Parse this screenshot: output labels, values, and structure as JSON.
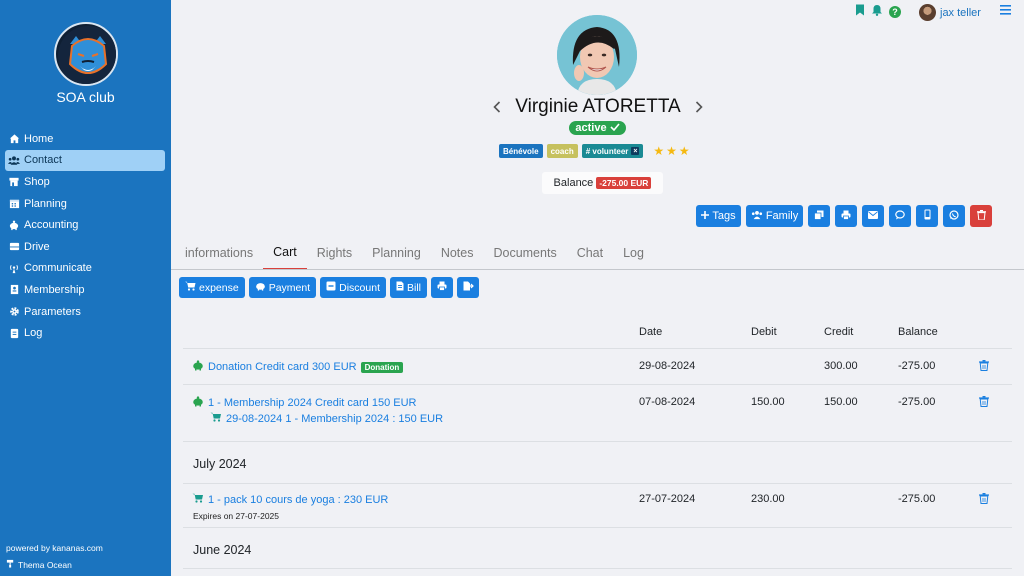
{
  "sidebar": {
    "club_name": "SOA club",
    "nav": [
      {
        "label": "Home",
        "icon": "home-icon",
        "active": false
      },
      {
        "label": "Contact",
        "icon": "users-icon",
        "active": true
      },
      {
        "label": "Shop",
        "icon": "shop-icon",
        "active": false
      },
      {
        "label": "Planning",
        "icon": "calendar-icon",
        "active": false
      },
      {
        "label": "Accounting",
        "icon": "piggy-bank-icon",
        "active": false
      },
      {
        "label": "Drive",
        "icon": "drive-icon",
        "active": false
      },
      {
        "label": "Communicate",
        "icon": "broadcast-icon",
        "active": false
      },
      {
        "label": "Membership",
        "icon": "id-card-icon",
        "active": false
      },
      {
        "label": "Parameters",
        "icon": "gear-icon",
        "active": false
      },
      {
        "label": "Log",
        "icon": "log-icon",
        "active": false
      }
    ],
    "powered_by": "powered by kananas.com",
    "theme": "Thema Ocean"
  },
  "topbar": {
    "user_name": "jax teller",
    "help_label": "?"
  },
  "profile": {
    "name": "Virginie ATORETTA",
    "status": "active",
    "tags": [
      {
        "label": "Bénévole",
        "style": "blue"
      },
      {
        "label": "coach",
        "style": "yellow"
      },
      {
        "label": "# volunteer",
        "style": "teal",
        "removable": true,
        "remove_label": "×"
      }
    ],
    "rating": 3,
    "balance_label": "Balance",
    "balance_amount": "-275.00 EUR"
  },
  "actions": {
    "tags": "Tags",
    "family": "Family",
    "icons": [
      "copy-icon",
      "print-icon",
      "email-icon",
      "chat-icon",
      "mobile-icon",
      "whatsapp-icon",
      "trash-icon"
    ]
  },
  "tabs": [
    {
      "label": "informations",
      "active": false
    },
    {
      "label": "Cart",
      "active": true
    },
    {
      "label": "Rights",
      "active": false
    },
    {
      "label": "Planning",
      "active": false
    },
    {
      "label": "Notes",
      "active": false
    },
    {
      "label": "Documents",
      "active": false
    },
    {
      "label": "Chat",
      "active": false
    },
    {
      "label": "Log",
      "active": false
    }
  ],
  "cart_toolbar": {
    "expense": "expense",
    "payment": "Payment",
    "discount": "Discount",
    "bill": "Bill"
  },
  "table": {
    "headers": {
      "date": "Date",
      "debit": "Debit",
      "credit": "Credit",
      "balance": "Balance"
    },
    "rows": [
      {
        "description": "Donation Credit card 300 EUR",
        "badge": "Donation",
        "date": "29-08-2024",
        "debit": "",
        "credit": "300.00",
        "balance": "-275.00"
      },
      {
        "description": "1 - Membership 2024 Credit card 150 EUR",
        "sub": "29-08-2024 1 - Membership 2024 : 150 EUR",
        "date": "07-08-2024",
        "debit": "150.00",
        "credit": "150.00",
        "balance": "-275.00"
      }
    ],
    "months": [
      "July 2024",
      "June 2024"
    ],
    "july_rows": [
      {
        "description": "1 - pack 10 cours de yoga : 230 EUR",
        "note": "Expires on 27-07-2025",
        "date": "27-07-2024",
        "debit": "230.00",
        "credit": "",
        "balance": "-275.00"
      }
    ]
  },
  "colors": {
    "sidebar": "#1b74bf",
    "primary": "#1a7fe0",
    "danger": "#d9403b",
    "success": "#2aa44f"
  }
}
